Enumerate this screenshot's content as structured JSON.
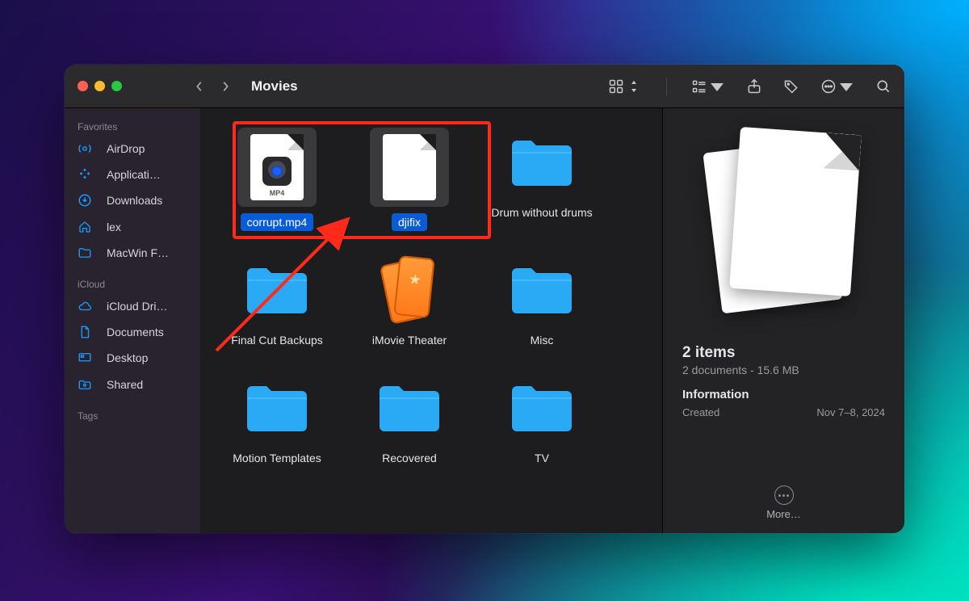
{
  "window": {
    "title": "Movies"
  },
  "sidebar": {
    "sections": [
      {
        "title": "Favorites",
        "items": [
          {
            "icon": "airdrop",
            "label": "AirDrop"
          },
          {
            "icon": "apps",
            "label": "Applicati…"
          },
          {
            "icon": "downloads",
            "label": "Downloads"
          },
          {
            "icon": "home",
            "label": "lex"
          },
          {
            "icon": "folder",
            "label": "MacWin F…"
          }
        ]
      },
      {
        "title": "iCloud",
        "items": [
          {
            "icon": "cloud",
            "label": "iCloud Dri…"
          },
          {
            "icon": "doc",
            "label": "Documents"
          },
          {
            "icon": "desktop",
            "label": "Desktop"
          },
          {
            "icon": "shared",
            "label": "Shared"
          }
        ]
      },
      {
        "title": "Tags",
        "items": []
      }
    ]
  },
  "items": [
    {
      "kind": "mp4",
      "label": "corrupt.mp4",
      "selected": true
    },
    {
      "kind": "doc",
      "label": "djifix",
      "selected": true
    },
    {
      "kind": "folder",
      "label": "Drum without drums"
    },
    {
      "kind": "folder",
      "label": "Final Cut Backups"
    },
    {
      "kind": "imovie",
      "label": "iMovie Theater"
    },
    {
      "kind": "folder",
      "label": "Misc"
    },
    {
      "kind": "folder",
      "label": "Motion Templates"
    },
    {
      "kind": "folder",
      "label": "Recovered"
    },
    {
      "kind": "folder",
      "label": "TV"
    }
  ],
  "preview": {
    "title": "2 items",
    "subtitle": "2 documents - 15.6 MB",
    "info_heading": "Information",
    "created_label": "Created",
    "created_value": "Nov 7–8, 2024",
    "more_label": "More…"
  },
  "annotation": {
    "highlight_color": "#ff2a1a"
  }
}
